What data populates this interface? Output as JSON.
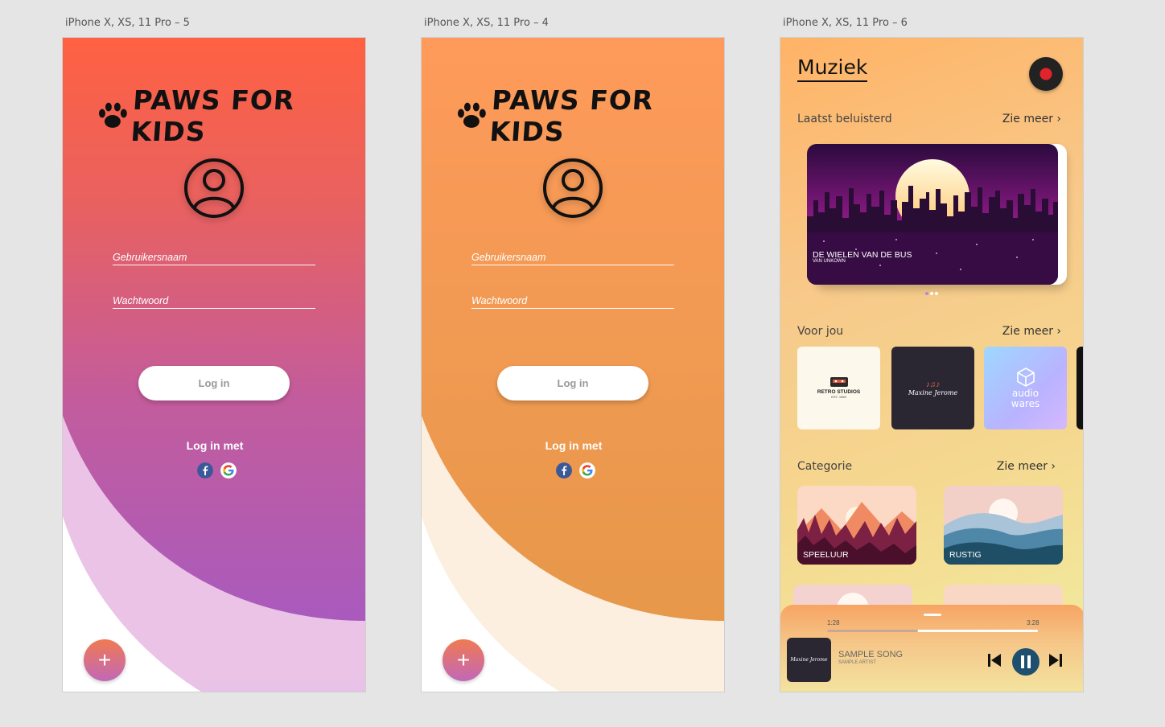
{
  "artboards": {
    "one": {
      "label": "iPhone X, XS, 11 Pro – 5"
    },
    "two": {
      "label": "iPhone X, XS, 11 Pro – 4"
    },
    "three": {
      "label": "iPhone X, XS, 11 Pro – 6"
    }
  },
  "login": {
    "brand": "PAWS FOR KIDS",
    "username_placeholder": "Gebruikersnaam",
    "password_placeholder": "Wachtwoord",
    "login_button": "Log in",
    "login_with": "Log in met",
    "social": [
      "facebook-icon",
      "google-icon"
    ],
    "fab": "+"
  },
  "music": {
    "title": "Muziek",
    "see_more": "Zie meer ›",
    "recent": {
      "heading": "Laatst beluisterd",
      "card_title": "DE WIELEN VAN DE BUS",
      "card_subtitle": "VAN UNKOWN"
    },
    "for_you": {
      "heading": "Voor jou",
      "tiles": [
        {
          "name": "RETRO STUDIOS",
          "sub": "EST. 1989"
        },
        {
          "name": "Maxine Jerome"
        },
        {
          "name": "audio",
          "sub": "wares"
        }
      ]
    },
    "category": {
      "heading": "Categorie",
      "items": [
        "SPEELUUR",
        "RUSTIG"
      ]
    },
    "player": {
      "elapsed": "1:28",
      "duration": "3:28",
      "progress": 0.43,
      "song": "SAMPLE SONG",
      "artist": "SAMPLE ARTIST",
      "album_label": "Maxine Jerome"
    }
  },
  "colors": {
    "coral": "#ff6142",
    "purple": "#a15ac8",
    "orange": "#ff9a5a",
    "player_button": "#1f4f6e"
  }
}
